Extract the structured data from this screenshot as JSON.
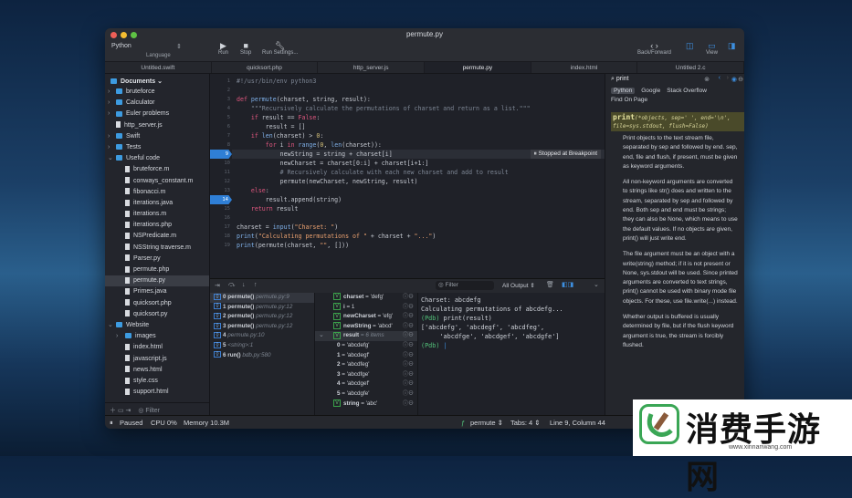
{
  "window": {
    "title": "permute.py",
    "language": "Python",
    "language_caption": "Language",
    "toolbar": {
      "run": "Run",
      "stop": "Stop",
      "run_settings": "Run Settings...",
      "back_forward": "Back/Forward",
      "view": "View"
    }
  },
  "tabs": [
    "Untitled.swift",
    "quicksort.php",
    "http_server.js",
    "permute.py",
    "index.html",
    "Untitled 2.c"
  ],
  "sidebar": {
    "title": "Documents",
    "filter_placeholder": "Filter",
    "items": [
      {
        "label": "bruteforce",
        "type": "folder",
        "depth": 0,
        "chev": "closed"
      },
      {
        "label": "Calculator",
        "type": "folder",
        "depth": 0,
        "chev": "closed"
      },
      {
        "label": "Euler problems",
        "type": "folder",
        "depth": 0,
        "chev": "closed"
      },
      {
        "label": "http_server.js",
        "type": "file",
        "depth": 0
      },
      {
        "label": "Swift",
        "type": "folder",
        "depth": 0,
        "chev": "closed"
      },
      {
        "label": "Tests",
        "type": "folder",
        "depth": 0,
        "chev": "closed"
      },
      {
        "label": "Useful code",
        "type": "folder",
        "depth": 0,
        "chev": "open"
      },
      {
        "label": "bruteforce.m",
        "type": "file",
        "depth": 1
      },
      {
        "label": "conways_constant.m",
        "type": "file",
        "depth": 1
      },
      {
        "label": "fibonacci.m",
        "type": "file",
        "depth": 1
      },
      {
        "label": "iterations.java",
        "type": "file",
        "depth": 1
      },
      {
        "label": "iterations.m",
        "type": "file",
        "depth": 1
      },
      {
        "label": "iterations.php",
        "type": "file",
        "depth": 1
      },
      {
        "label": "NSPredicate.m",
        "type": "file",
        "depth": 1
      },
      {
        "label": "NSString traverse.m",
        "type": "file",
        "depth": 1
      },
      {
        "label": "Parser.py",
        "type": "file",
        "depth": 1
      },
      {
        "label": "permute.php",
        "type": "file",
        "depth": 1
      },
      {
        "label": "permute.py",
        "type": "file",
        "depth": 1,
        "selected": true
      },
      {
        "label": "Primes.java",
        "type": "file",
        "depth": 1
      },
      {
        "label": "quicksort.php",
        "type": "file",
        "depth": 1
      },
      {
        "label": "quicksort.py",
        "type": "file",
        "depth": 1
      },
      {
        "label": "Website",
        "type": "folder",
        "depth": 0,
        "chev": "open"
      },
      {
        "label": "images",
        "type": "folder",
        "depth": 1,
        "chev": "closed"
      },
      {
        "label": "index.html",
        "type": "file",
        "depth": 1
      },
      {
        "label": "javascript.js",
        "type": "file",
        "depth": 1
      },
      {
        "label": "news.html",
        "type": "file",
        "depth": 1
      },
      {
        "label": "style.css",
        "type": "file",
        "depth": 1
      },
      {
        "label": "support.html",
        "type": "file",
        "depth": 1
      }
    ]
  },
  "editor": {
    "breakpoint_message": "Stopped at Breakpoint",
    "current_line": 9,
    "breakpoints": [
      9,
      14
    ],
    "lines": [
      [
        [
          "c",
          "#!/usr/bin/env python3"
        ]
      ],
      [],
      [
        [
          "k",
          "def "
        ],
        [
          "f",
          "permute"
        ],
        [
          "p",
          "(charset, string, result):"
        ]
      ],
      [
        [
          "c",
          "    \"\"\"Recursively calculate the permutations of charset and return as a list.\"\"\""
        ]
      ],
      [
        [
          "k",
          "    if "
        ],
        [
          "p",
          "result == "
        ],
        [
          "k",
          "False"
        ],
        [
          "p",
          ":"
        ]
      ],
      [
        [
          "p",
          "        result = []"
        ]
      ],
      [
        [
          "k",
          "    if "
        ],
        [
          "b",
          "len"
        ],
        [
          "p",
          "(charset) > "
        ],
        [
          "n",
          "0"
        ],
        [
          "p",
          ":"
        ]
      ],
      [
        [
          "k",
          "        for "
        ],
        [
          "p",
          "i "
        ],
        [
          "k",
          "in "
        ],
        [
          "b",
          "range"
        ],
        [
          "p",
          "("
        ],
        [
          "n",
          "0"
        ],
        [
          "p",
          ", "
        ],
        [
          "b",
          "len"
        ],
        [
          "p",
          "(charset)):"
        ]
      ],
      [
        [
          "p",
          "            newString = string + charset[i]"
        ]
      ],
      [
        [
          "p",
          "            newCharset = charset[0:i] + charset[i+1:]"
        ]
      ],
      [
        [
          "c",
          "            # Recursively calculate with each new charset and add to result"
        ]
      ],
      [
        [
          "p",
          "            permute(newCharset, newString, result)"
        ]
      ],
      [
        [
          "k",
          "    else"
        ],
        [
          "p",
          ":"
        ]
      ],
      [
        [
          "p",
          "        result.append(string)"
        ]
      ],
      [
        [
          "k",
          "    return "
        ],
        [
          "p",
          "result"
        ]
      ],
      [],
      [
        [
          "p",
          "charset = "
        ],
        [
          "b",
          "input"
        ],
        [
          "p",
          "("
        ],
        [
          "s",
          "\"Charset: \""
        ],
        [
          "p",
          ")"
        ]
      ],
      [
        [
          "b",
          "print"
        ],
        [
          "p",
          "("
        ],
        [
          "s",
          "\"Calculating permutations of \""
        ],
        [
          "p",
          " + charset + "
        ],
        [
          "s",
          "\"...\""
        ],
        [
          "p",
          ")"
        ]
      ],
      [
        [
          "b",
          "print"
        ],
        [
          "p",
          "(permute(charset, "
        ],
        [
          "s",
          "\"\""
        ],
        [
          "p",
          ", []))"
        ]
      ]
    ]
  },
  "debugger": {
    "filter_placeholder": "Filter",
    "output_select": "All Output",
    "stack": [
      {
        "n": "0",
        "fn": "permute()",
        "loc": "permute.py:9"
      },
      {
        "n": "1",
        "fn": "permute()",
        "loc": "permute.py:12"
      },
      {
        "n": "2",
        "fn": "permute()",
        "loc": "permute.py:12"
      },
      {
        "n": "3",
        "fn": "permute()",
        "loc": "permute.py:12"
      },
      {
        "n": "4",
        "fn": "",
        "loc": "permute.py:10"
      },
      {
        "n": "5",
        "fn": "",
        "loc": "<string>:1"
      },
      {
        "n": "6",
        "fn": "run()",
        "loc": "bdb.py:580"
      }
    ],
    "variables": [
      {
        "name": "charset",
        "value": " = 'defg'",
        "v": true
      },
      {
        "name": "i",
        "value": " = 1",
        "v": true
      },
      {
        "name": "newCharset",
        "value": " = 'efg'",
        "v": true
      },
      {
        "name": "newString",
        "value": " = 'abcd'",
        "v": true
      },
      {
        "name": "result",
        "value": " = 6 items",
        "v": true,
        "open": true
      },
      {
        "name": "0",
        "value": " = 'abcdefg'",
        "child": true
      },
      {
        "name": "1",
        "value": " = 'abcdegf'",
        "child": true
      },
      {
        "name": "2",
        "value": " = 'abcdfeg'",
        "child": true
      },
      {
        "name": "3",
        "value": " = 'abcdfge'",
        "child": true
      },
      {
        "name": "4",
        "value": " = 'abcdgef'",
        "child": true
      },
      {
        "name": "5",
        "value": " = 'abcdgfe'",
        "child": true
      },
      {
        "name": "string",
        "value": " = 'abc'",
        "v": true
      }
    ],
    "console": [
      "Charset: abcdefg",
      "Calculating permutations of abcdefg...",
      "(Pdb) print(result)",
      "['abcdefg', 'abcdegf', 'abcdfeg',",
      "     'abcdfge', 'abcdgef', 'abcdgfe']",
      "(Pdb) "
    ]
  },
  "docs": {
    "search": "print",
    "tabs": [
      "Python",
      "Google",
      "Stack Overflow",
      "Find On Page"
    ],
    "signature": "print",
    "signature_args": "(*objects, sep=' ', end='\\n', file=sys.stdout, flush=False)",
    "paragraphs": [
      "Print objects to the text stream file, separated by sep and followed by end. sep, end, file and flush, if present, must be given as keyword arguments.",
      "All non-keyword arguments are converted to strings like str() does and written to the stream, separated by sep and followed by end. Both sep and end must be strings; they can also be None, which means to use the default values. If no objects are given, print() will just write end.",
      "The file argument must be an object with a write(string) method; if it is not present or None, sys.stdout will be used. Since printed arguments are converted to text strings, print() cannot be used with binary mode file objects. For these, use file.write(...) instead.",
      "Whether output is buffered is usually determined by file, but if the flush keyword argument is true, the stream is forcibly flushed."
    ]
  },
  "status": {
    "state": "Paused",
    "cpu": "CPU 0%",
    "memory": "Memory 10.3M",
    "function": "permute",
    "tabs": "Tabs: 4",
    "position": "Line 9, Column 44"
  },
  "watermark": {
    "text": "消费手游网",
    "url": "www.xinnanwang.com"
  }
}
